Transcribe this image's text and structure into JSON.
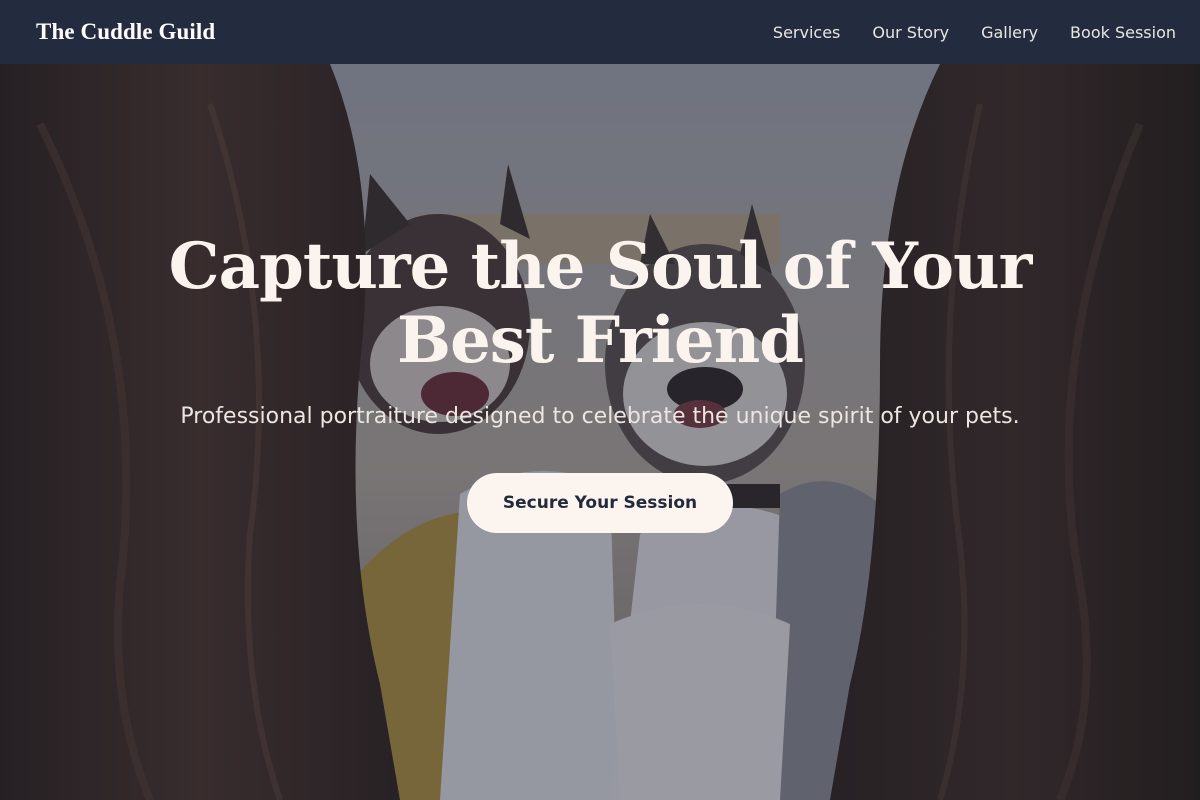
{
  "header": {
    "logo": "The Cuddle Guild",
    "nav": [
      {
        "label": "Services"
      },
      {
        "label": "Our Story"
      },
      {
        "label": "Gallery"
      },
      {
        "label": "Book Session"
      }
    ]
  },
  "hero": {
    "title": "Capture the Soul of Your Best Friend",
    "subtitle": "Professional portraiture designed to celebrate the unique spirit of your pets.",
    "cta_label": "Secure Your Session",
    "background": "two people with long dark hair holding two French bulldogs"
  },
  "colors": {
    "nav_background": "#232c3f",
    "hero_text": "#fbf4ee",
    "cta_background": "#fcf4ee",
    "cta_text": "#232a3b"
  }
}
